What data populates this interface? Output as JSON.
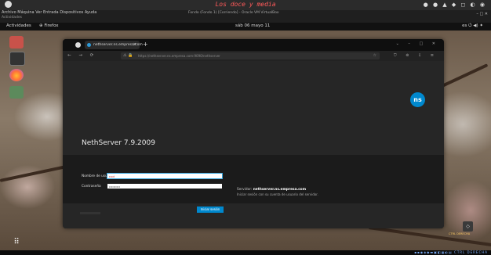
{
  "host": {
    "title": "Los doce y media",
    "menu_line1": "Archivo  Máquina  Ver  Entrada  Dispositivos  Ayuda",
    "menu_line2": "Actividades",
    "subtitle": "Fondo (Fondo 1) [Corriendo] - Oracle VM VirtualBox",
    "window_controls": "– □ ✕",
    "tray": "● ● ▲ ◆ ◻ ◐ ◉"
  },
  "gnome": {
    "activities": "Actividades",
    "app": "⊕ Firefox",
    "clock": "sáb 06 mayo  11",
    "system": "es  ⏻  ◀)  ✦"
  },
  "browser": {
    "tab_label": "nethserver.ns.empresa.com",
    "tab_close": "×",
    "new_tab": "+",
    "window_buttons": "⌄ – □ ✕",
    "nav_buttons": "← → ⟳",
    "url": "https://nethserver.ns.empresa.com:9090/nethserver",
    "url_icons": "⚠ 🔒",
    "star": "☆",
    "tools": "⛉ ⊚ ⇩ ≡"
  },
  "login": {
    "logo_text": "ns",
    "product": "NethServer 7.9.2009",
    "username_label": "Nombre de usuario",
    "username_value": "root",
    "password_label": "Contraseña",
    "password_value": "••••••••••",
    "submit": "Iniciar sesión",
    "server_prefix": "Servidor:",
    "server_name": "nethserver.ns.empresa.com",
    "server_note": "Iniciar sesión con su cuenta de usuario del servidor."
  },
  "desktop": {
    "apps_grid": "⠿",
    "notif_label": "◇",
    "notif_text": "CTRL DERECHA"
  },
  "taskbar": {
    "icons": "▪▪◉◈◆▬▣◧▦◐▤ CTRL DERECHA"
  }
}
